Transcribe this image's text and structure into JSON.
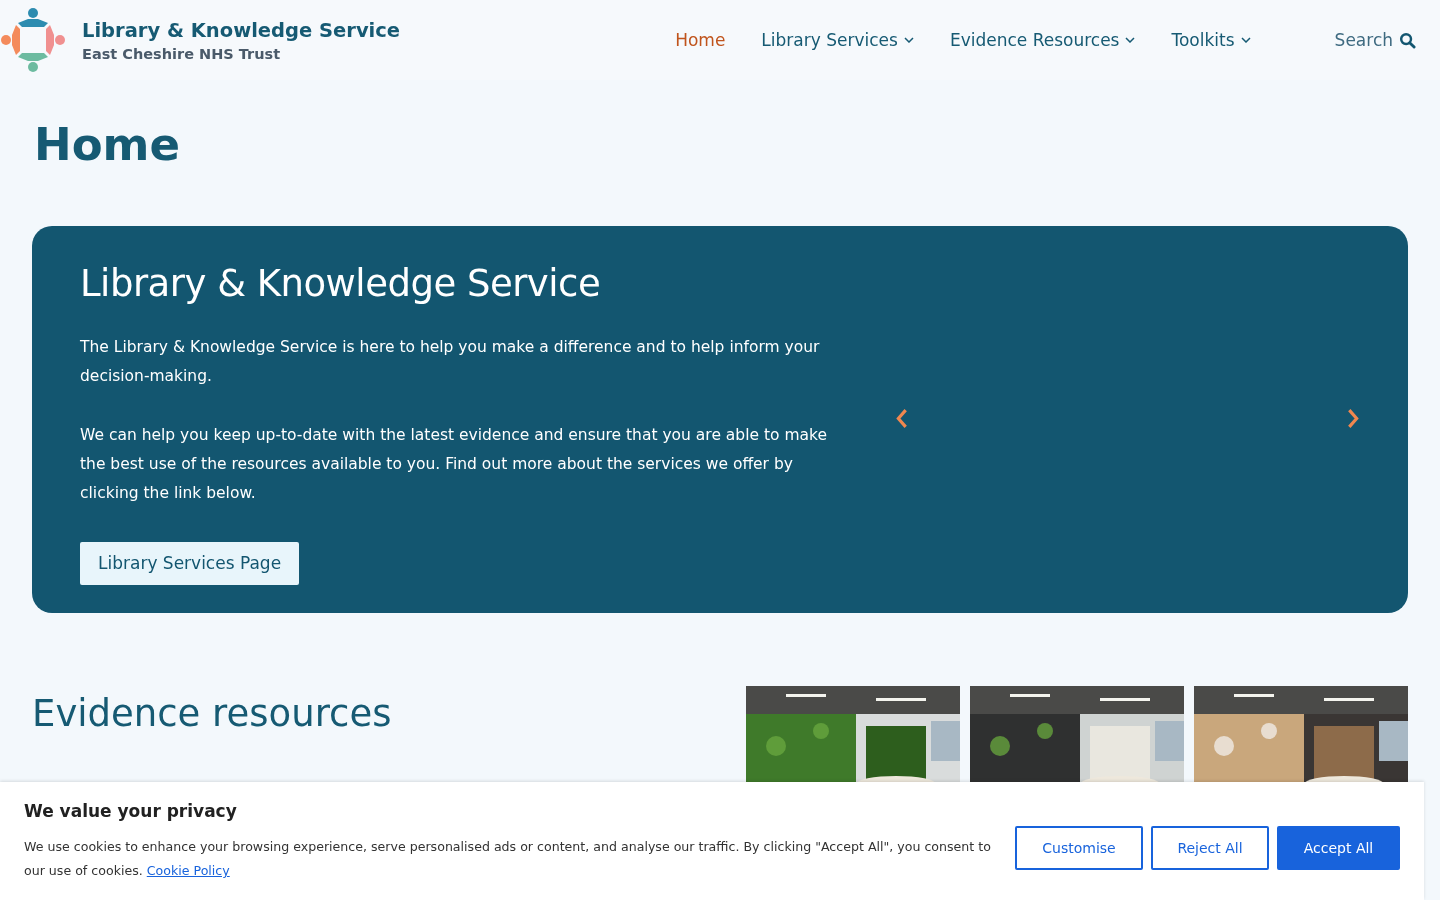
{
  "header": {
    "title": "Library & Knowledge Service",
    "subtitle": "East Cheshire NHS Trust"
  },
  "nav": [
    {
      "label": "Home",
      "selected": true,
      "dropdown": false
    },
    {
      "label": "Library Services",
      "selected": false,
      "dropdown": true
    },
    {
      "label": "Evidence Resources",
      "selected": false,
      "dropdown": true
    },
    {
      "label": "Toolkits",
      "selected": false,
      "dropdown": true
    }
  ],
  "search": {
    "label": "Search"
  },
  "page_title": "Home",
  "hero": {
    "title": "Library & Knowledge Service",
    "paragraphs": [
      "The Library & Knowledge Service is here to help you make a difference and to help inform your decision-making.",
      "We can help you keep up-to-date with the latest evidence and ensure that you are able to make the best use of the resources available to you. Find out more about the services we offer by clicking the link below."
    ],
    "button": "Library Services Page"
  },
  "evidence": {
    "title": "Evidence resources"
  },
  "cookie_banner": {
    "title": "We value your privacy",
    "text": "We use cookies to enhance your browsing experience, serve personalised ads or content, and analyse our traffic. By clicking \"Accept All\", you consent to our use of cookies.",
    "link": "Cookie Policy",
    "buttons": [
      {
        "label": "Customise",
        "kind": "outline"
      },
      {
        "label": "Reject All",
        "kind": "outline"
      },
      {
        "label": "Accept All",
        "kind": "primary"
      }
    ]
  }
}
